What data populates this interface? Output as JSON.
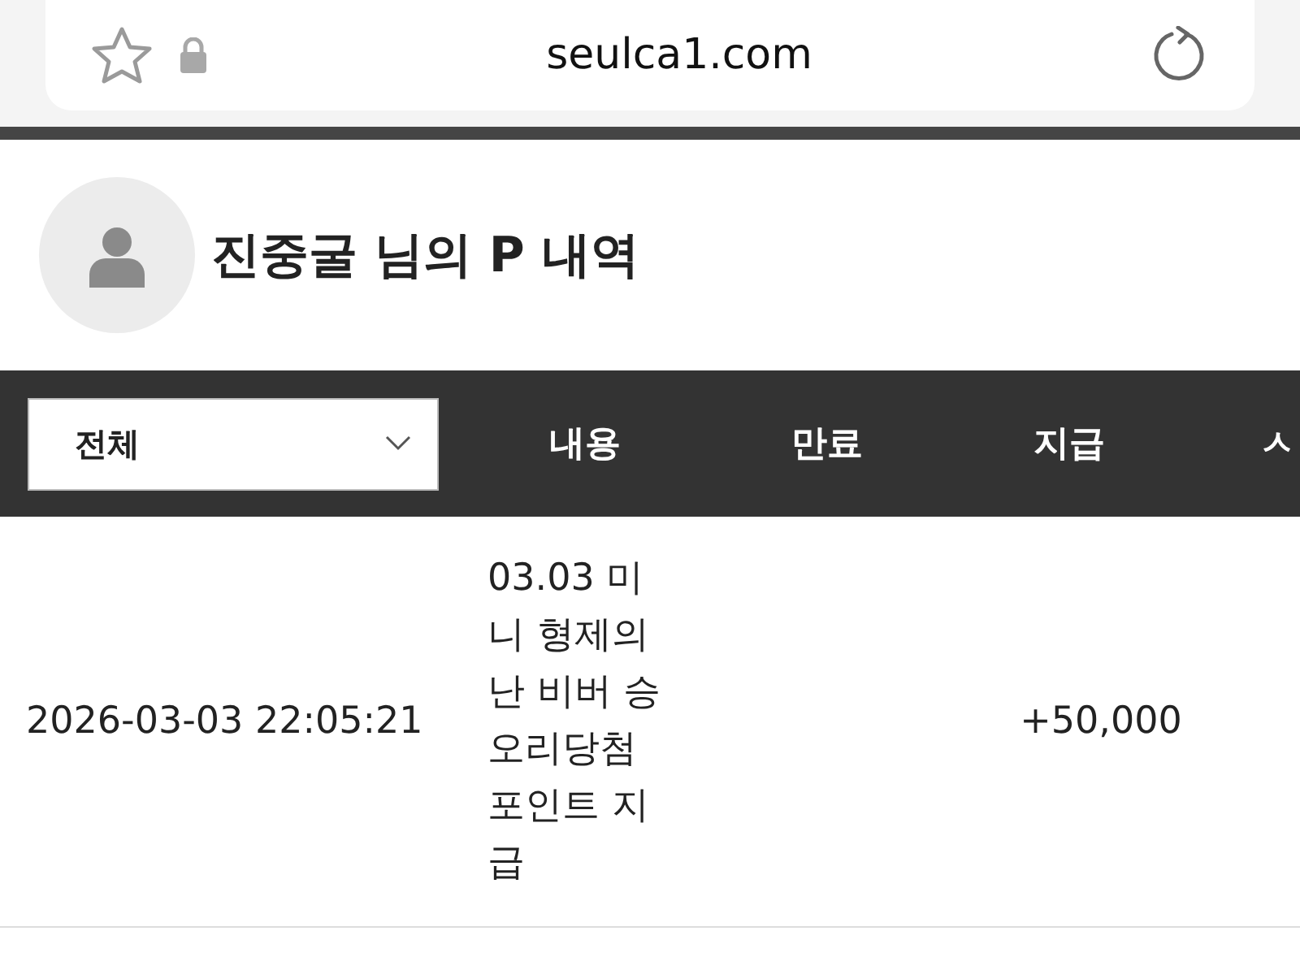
{
  "address_bar": {
    "url": "seulca1.com"
  },
  "profile": {
    "title": "진중굴 님의 P 내역"
  },
  "table": {
    "filter": {
      "value": "전체"
    },
    "columns": [
      "내용",
      "만료",
      "지급",
      "ㅅ"
    ],
    "rows": [
      {
        "date": "2026-03-03 22:05:21",
        "content": "03.03 미니 형제의난 비버 승오리당첨 포인트 지급",
        "expiry": "",
        "payment": "+50,000"
      }
    ]
  }
}
